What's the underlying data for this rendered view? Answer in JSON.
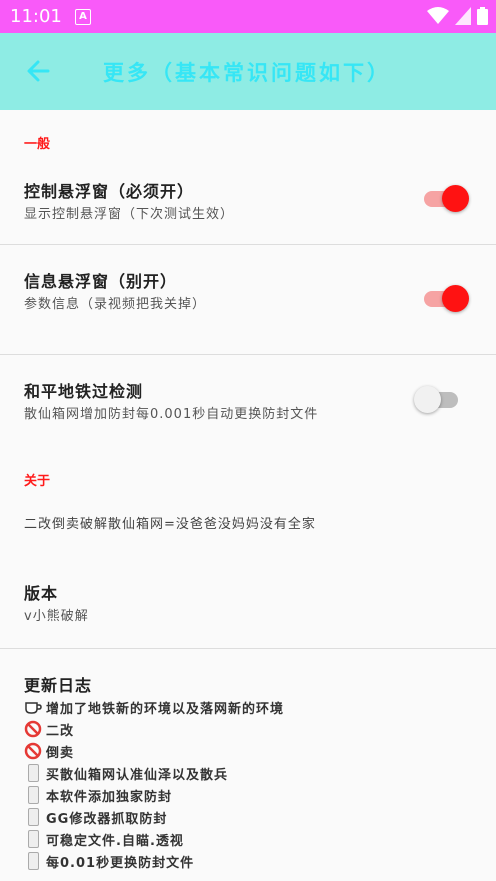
{
  "status_bar": {
    "time": "11:01",
    "notification": "A"
  },
  "toolbar": {
    "title": "更多（基本常识问题如下）"
  },
  "sections": {
    "general": "一般",
    "about": "关于"
  },
  "prefs": {
    "control_float": {
      "title": "控制悬浮窗（必须开）",
      "summary": "显示控制悬浮窗（下次测试生效）",
      "on": true
    },
    "info_float": {
      "title": "信息悬浮窗（别开）",
      "summary": "参数信息（录视频把我关掉）",
      "on": true
    },
    "peace_bypass": {
      "title": "和平地铁过检测",
      "summary": "散仙箱网增加防封每0.001秒自动更换防封文件",
      "on": false
    }
  },
  "about": {
    "note": "二改倒卖破解散仙箱网=没爸爸没妈妈没有全家",
    "version_title": "版本",
    "version_value": "v小熊破解",
    "changelog_title": "更新日志",
    "changelog": [
      {
        "icon": "coffee-icon",
        "text": "增加了地铁新的环境以及落网新的环境"
      },
      {
        "icon": "prohibited-icon",
        "text": "二改"
      },
      {
        "icon": "prohibited-icon",
        "text": "倒卖"
      },
      {
        "icon": "phone-icon",
        "text": "买散仙箱网认准仙泽以及散兵"
      },
      {
        "icon": "phone-icon",
        "text": "本软件添加独家防封"
      },
      {
        "icon": "phone-icon",
        "text": "GG修改器抓取防封"
      },
      {
        "icon": "phone-icon",
        "text": "可稳定文件.自瞄.透视"
      },
      {
        "icon": "phone-icon",
        "text": "每0.01秒更换防封文件"
      }
    ]
  },
  "colors": {
    "status_bar": "#f95af9",
    "toolbar": "#8eece4",
    "title": "#36e6f5",
    "accent": "#ff1212"
  }
}
